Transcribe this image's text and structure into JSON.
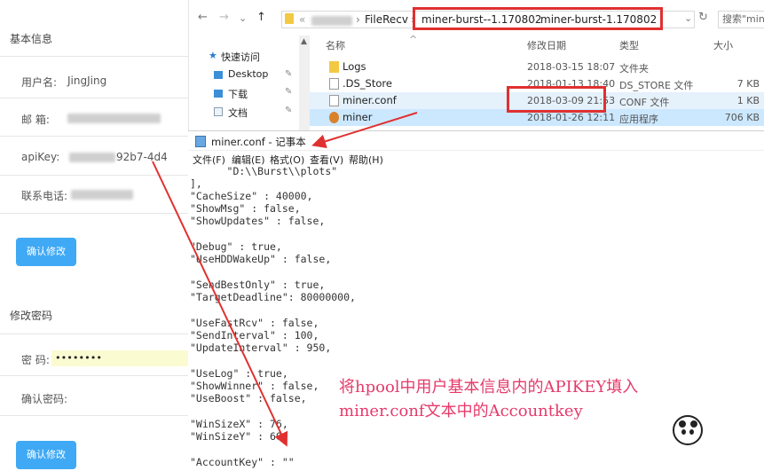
{
  "profile": {
    "section_basic": "基本信息",
    "username_label": "用户名:",
    "username_value": "JingJing",
    "email_label": "邮  箱:",
    "apikey_label": "apiKey:",
    "apikey_value": "92b7-4d4",
    "phone_label": "联系电话:",
    "confirm_button": "确认修改",
    "section_password": "修改密码",
    "password_label": "密  码:",
    "password_value": "••••••••",
    "confirm_password_label": "确认密码:",
    "confirm_button_2": "确认修改"
  },
  "explorer": {
    "back": "←",
    "forward": "→",
    "up": "↑",
    "breadcrumb_root": "FileRecv",
    "breadcrumb_1": "miner-burst--1.170802",
    "breadcrumb_2": "miner-burst-1.170802",
    "refresh": "↻",
    "search_placeholder": "搜索\"min",
    "quick_access": "快速访问",
    "nav_items": [
      "Desktop",
      "下载",
      "文档"
    ],
    "columns": {
      "name": "名称",
      "date": "修改日期",
      "type": "类型",
      "size": "大小"
    },
    "files": [
      {
        "name": "Logs",
        "date": "2018-03-15 18:07",
        "type": "文件夹",
        "size": ""
      },
      {
        "name": ".DS_Store",
        "date": "2018-01-13 18:40",
        "type": "DS_STORE 文件",
        "size": "7 KB"
      },
      {
        "name": "miner.conf",
        "date": "2018-03-09 21:53",
        "type": "CONF 文件",
        "size": "1 KB"
      },
      {
        "name": "miner",
        "date": "2018-01-26 12:11",
        "type": "应用程序",
        "size": "706 KB"
      }
    ]
  },
  "notepad": {
    "title": "miner.conf - 记事本",
    "menu": [
      "文件(F)",
      "编辑(E)",
      "格式(O)",
      "查看(V)",
      "帮助(H)"
    ],
    "lines": [
      "      \"D:\\\\Burst\\\\plots\"",
      "],",
      "\"CacheSize\" : 40000,",
      "\"ShowMsg\" : false,",
      "\"ShowUpdates\" : false,",
      "",
      "\"Debug\" : true,",
      "\"UseHDDWakeUp\" : false,",
      "",
      "\"SendBestOnly\" : true,",
      "\"TargetDeadline\": 80000000,",
      "",
      "\"UseFastRcv\" : false,",
      "\"SendInterval\" : 100,",
      "\"UpdateInterval\" : 950,",
      "",
      "\"UseLog\" : true,",
      "\"ShowWinner\" : false,",
      "\"UseBoost\" : false,",
      "",
      "\"WinSizeX\" : 76,",
      "\"WinSizeY\" : 60,",
      "",
      "\"AccountKey\" : \"\""
    ]
  },
  "annotation": {
    "line1": "将hpool中用户基本信息内的APIKEY填入",
    "line2": "miner.conf文本中的Accountkey"
  },
  "colors": {
    "highlight_red": "#e03030",
    "annotation_pink": "#e53a6a",
    "button_blue": "#3fa9f5"
  }
}
